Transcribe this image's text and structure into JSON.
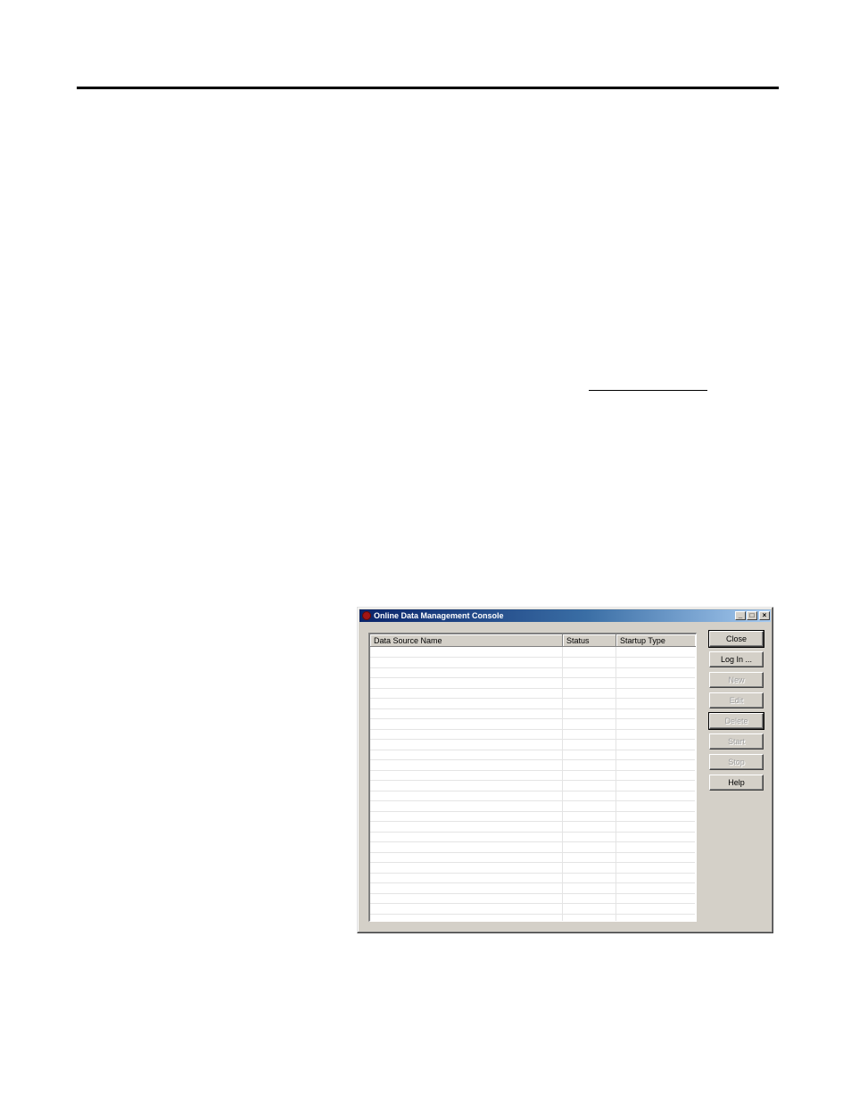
{
  "window": {
    "title": "Online Data Management Console",
    "controls": {
      "minimize": "_",
      "maximize": "□",
      "close": "×"
    }
  },
  "table": {
    "columns": [
      "Data Source Name",
      "Status",
      "Startup Type"
    ],
    "rows": []
  },
  "buttons": {
    "close": "Close",
    "login": "Log In ...",
    "new": "New",
    "edit": "Edit",
    "delete": "Delete",
    "start": "Start",
    "stop": "Stop",
    "help": "Help"
  },
  "colors": {
    "titlebar_start": "#0a246a",
    "titlebar_end": "#a6caf0",
    "dialog_face": "#d4d0c8"
  }
}
